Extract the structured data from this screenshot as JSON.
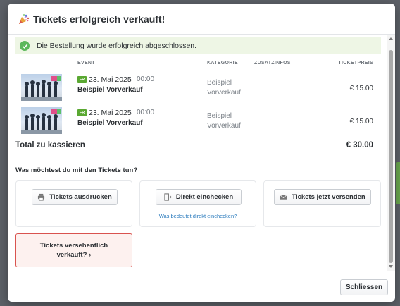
{
  "modal": {
    "title": "Tickets erfolgreich verkauft!",
    "success_message": "Die Bestellung wurde erfolgreich abgeschlossen."
  },
  "table": {
    "headers": {
      "event": "EVENT",
      "category": "KATEGORIE",
      "extra_info": "ZUSATZINFOS",
      "price": "TICKETPREIS"
    },
    "rows": [
      {
        "weekday": "FR",
        "date": "23. Mai 2025",
        "time": "00:00",
        "event_name": "Beispiel Vorverkauf",
        "category_line1": "Beispiel",
        "category_line2": "Vorverkauf",
        "extra_info": "",
        "price": "€ 15.00"
      },
      {
        "weekday": "FR",
        "date": "23. Mai 2025",
        "time": "00:00",
        "event_name": "Beispiel Vorverkauf",
        "category_line1": "Beispiel",
        "category_line2": "Vorverkauf",
        "extra_info": "",
        "price": "€ 15.00"
      }
    ]
  },
  "total": {
    "label": "Total zu kassieren",
    "value": "€ 30.00"
  },
  "actions": {
    "question": "Was möchtest du mit den Tickets tun?",
    "print_label": "Tickets ausdrucken",
    "checkin_label": "Direkt einchecken",
    "checkin_help": "Was bedeutet direkt einchecken?",
    "send_label": "Tickets jetzt versenden",
    "mistake_line1": "Tickets versehentlich",
    "mistake_line2": "verkauft?"
  },
  "footer": {
    "close_label": "Schliessen"
  },
  "colors": {
    "success_bg": "#eef6e5",
    "success_check": "#5cb85c",
    "weekday_badge": "#5aa832",
    "link": "#2b7bbd",
    "danger_border": "#d9534f",
    "danger_bg": "#fdf1ef"
  },
  "icons": {
    "title": "party-popper-icon",
    "success": "check-circle-icon",
    "print": "printer-icon",
    "checkin": "door-enter-icon",
    "send": "envelope-icon",
    "mistake": "chevron-right-icon"
  }
}
